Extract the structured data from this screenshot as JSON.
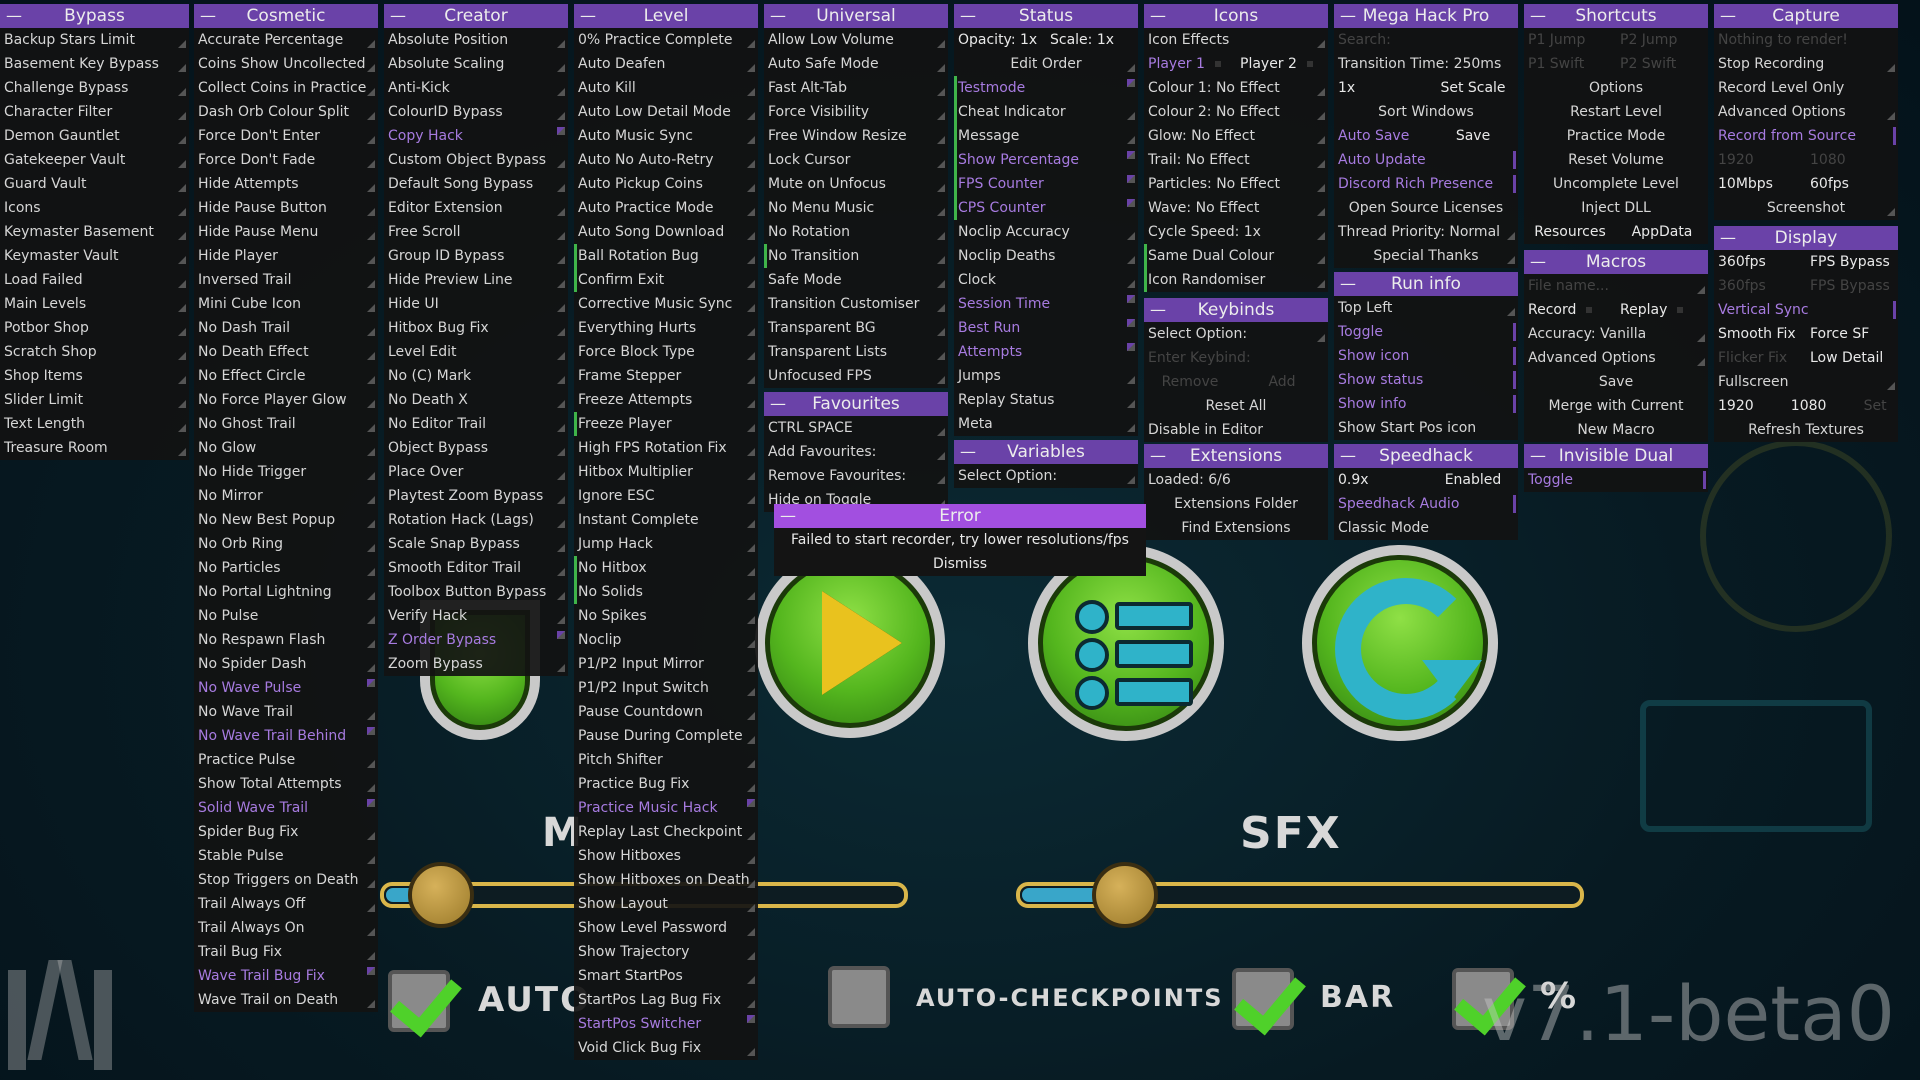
{
  "panels": {
    "bypass": {
      "title": "Bypass",
      "items": [
        "Backup Stars Limit",
        "Basement Key Bypass",
        "Challenge Bypass",
        "Character Filter",
        "Demon Gauntlet",
        "Gatekeeper Vault",
        "Guard Vault",
        "Icons",
        "Keymaster Basement",
        "Keymaster Vault",
        "Load Failed",
        "Main Levels",
        "Potbor Shop",
        "Scratch Shop",
        "Shop Items",
        "Slider Limit",
        "Text Length",
        "Treasure Room"
      ]
    },
    "cosmetic": {
      "title": "Cosmetic",
      "items": [
        "Accurate Percentage",
        "Coins Show Uncollected",
        "Collect Coins in Practice",
        "Dash Orb Colour Split",
        "Force Don't Enter",
        "Force Don't Fade",
        "Hide Attempts",
        "Hide Pause Button",
        "Hide Pause Menu",
        "Hide Player",
        "Inversed Trail",
        "Mini Cube Icon",
        "No Dash Trail",
        "No Death Effect",
        "No Effect Circle",
        "No Force Player Glow",
        "No Ghost Trail",
        "No Glow",
        "No Hide Trigger",
        "No Mirror",
        "No New Best Popup",
        "No Orb Ring",
        "No Particles",
        "No Portal Lightning",
        "No Pulse",
        "No Respawn Flash",
        "No Spider Dash",
        "No Wave Pulse",
        "No Wave Trail",
        "No Wave Trail Behind",
        "Practice Pulse",
        "Show Total Attempts",
        "Solid Wave Trail",
        "Spider Bug Fix",
        "Stable Pulse",
        "Stop Triggers on Death",
        "Trail Always Off",
        "Trail Always On",
        "Trail Bug Fix",
        "Wave Trail Bug Fix",
        "Wave Trail on Death"
      ]
    },
    "creator": {
      "title": "Creator",
      "items": [
        "Absolute Position",
        "Absolute Scaling",
        "Anti-Kick",
        "ColourID Bypass",
        "Copy Hack",
        "Custom Object Bypass",
        "Default Song Bypass",
        "Editor Extension",
        "Free Scroll",
        "Group ID Bypass",
        "Hide Preview Line",
        "Hide UI",
        "Hitbox Bug Fix",
        "Level Edit",
        "No (C) Mark",
        "No Death X",
        "No Editor Trail",
        "Object Bypass",
        "Place Over",
        "Playtest Zoom Bypass",
        "Rotation Hack (Lags)",
        "Scale Snap Bypass",
        "Smooth Editor Trail",
        "Toolbox Button Bypass",
        "Verify Hack",
        "Z Order Bypass",
        "Zoom Bypass"
      ]
    },
    "level": {
      "title": "Level",
      "items": [
        "0% Practice Complete",
        "Auto Deafen",
        "Auto Kill",
        "Auto Low Detail Mode",
        "Auto Music Sync",
        "Auto No Auto-Retry",
        "Auto Pickup Coins",
        "Auto Practice Mode",
        "Auto Song Download",
        "Ball Rotation Bug",
        "Confirm Exit",
        "Corrective Music Sync",
        "Everything Hurts",
        "Force Block Type",
        "Frame Stepper",
        "Freeze Attempts",
        "Freeze Player",
        "High FPS Rotation Fix",
        "Hitbox Multiplier",
        "Ignore ESC",
        "Instant Complete",
        "Jump Hack",
        "No Hitbox",
        "No Solids",
        "No Spikes",
        "Noclip",
        "P1/P2 Input Mirror",
        "P1/P2 Input Switch",
        "Pause Countdown",
        "Pause During Complete",
        "Pitch Shifter",
        "Practice Bug Fix",
        "Practice Music Hack",
        "Replay Last Checkpoint",
        "Show Hitboxes",
        "Show Hitboxes on Death",
        "Show Layout",
        "Show Level Password",
        "Show Trajectory",
        "Smart StartPos",
        "StartPos Lag Bug Fix",
        "StartPos Switcher",
        "Void Click Bug Fix"
      ]
    },
    "universal": {
      "title": "Universal",
      "items": [
        "Allow Low Volume",
        "Auto Safe Mode",
        "Fast Alt-Tab",
        "Force Visibility",
        "Free Window Resize",
        "Lock Cursor",
        "Mute on Unfocus",
        "No Menu Music",
        "No Rotation",
        "No Transition",
        "Safe Mode",
        "Transition Customiser",
        "Transparent BG",
        "Transparent Lists",
        "Unfocused FPS"
      ]
    },
    "favourites": {
      "title": "Favourites",
      "items": [
        "CTRL SPACE",
        "Add Favourites:",
        "Remove Favourites:",
        "Hide on Toggle"
      ]
    },
    "status": {
      "title": "Status",
      "opacity": "Opacity: 1x",
      "scale": "Scale: 1x",
      "items": [
        "Edit Order",
        "Testmode",
        "Cheat Indicator",
        "Message",
        "Show Percentage",
        "FPS Counter",
        "CPS Counter",
        "Noclip Accuracy",
        "Noclip Deaths",
        "Clock",
        "Session Time",
        "Best Run",
        "Attempts",
        "Jumps",
        "Replay Status",
        "Meta"
      ]
    },
    "variables": {
      "title": "Variables",
      "items": [
        "Select Option:"
      ]
    },
    "icons": {
      "title": "Icons",
      "player1": "Player 1",
      "player2": "Player 2",
      "items": [
        "Icon Effects",
        "Colour 1: No Effect",
        "Colour 2: No Effect",
        "Glow: No Effect",
        "Trail: No Effect",
        "Particles: No Effect",
        "Wave: No Effect",
        "Cycle Speed: 1x",
        "Same Dual Colour",
        "Icon Randomiser"
      ]
    },
    "keybinds": {
      "title": "Keybinds",
      "items": [
        "Select Option:",
        "Enter Keybind:",
        "Remove",
        "Add",
        "Reset All",
        "Disable in Editor"
      ]
    },
    "extensions": {
      "title": "Extensions",
      "items": [
        "Loaded: 6/6",
        "Extensions Folder",
        "Find Extensions"
      ]
    },
    "megahack": {
      "title": "Mega Hack Pro",
      "items": [
        "Search:",
        "Transition Time: 250ms",
        "1x",
        "Set Scale",
        "Sort Windows",
        "Auto Save",
        "Save",
        "Auto Update",
        "Discord Rich Presence",
        "Open Source Licenses",
        "Thread Priority: Normal",
        "Special Thanks"
      ]
    },
    "runinfo": {
      "title": "Run info",
      "items": [
        "Top Left",
        "Toggle",
        "Show icon",
        "Show status",
        "Show info",
        "Show Start Pos icon"
      ]
    },
    "speedhack": {
      "title": "Speedhack",
      "items": [
        "0.9x",
        "Enabled",
        "Speedhack Audio",
        "Classic Mode"
      ]
    },
    "shortcuts": {
      "title": "Shortcuts",
      "items": [
        "P1 Jump",
        "P2 Jump",
        "P1 Swift",
        "P2 Swift",
        "Options",
        "Restart Level",
        "Practice Mode",
        "Reset Volume",
        "Uncomplete Level",
        "Inject DLL",
        "Resources",
        "AppData"
      ]
    },
    "macros": {
      "title": "Macros",
      "items": [
        "File name...",
        "Record",
        "Replay",
        "Accuracy: Vanilla",
        "Advanced Options",
        "Save",
        "Merge with Current",
        "New Macro"
      ]
    },
    "invisibledual": {
      "title": "Invisible Dual",
      "items": [
        "Toggle"
      ]
    },
    "capture": {
      "title": "Capture",
      "items": [
        "Nothing to render!",
        "Stop Recording",
        "Record Level Only",
        "Advanced Options",
        "Record from Source",
        "1920",
        "1080",
        "10Mbps",
        "60fps",
        "Screenshot"
      ]
    },
    "display": {
      "title": "Display",
      "items": [
        "360fps",
        "FPS Bypass",
        "360fps",
        "FPS Bypass",
        "Vertical Sync",
        "Smooth Fix",
        "Force SF",
        "Flicker Fix",
        "Low Detail",
        "Fullscreen",
        "1920",
        "1080",
        "Set",
        "Refresh Textures"
      ]
    }
  },
  "error": {
    "title": "Error",
    "message": "Failed to start recorder, try lower resolutions/fps",
    "dismiss": "Dismiss"
  },
  "game": {
    "sfx_label": "SFX",
    "music_label": "M",
    "auto_label": "Auto",
    "auto_checkpoints": "Auto-Checkpoints",
    "bar_label": "Bar",
    "percent_label": "%",
    "version": "v7.1-beta0"
  }
}
